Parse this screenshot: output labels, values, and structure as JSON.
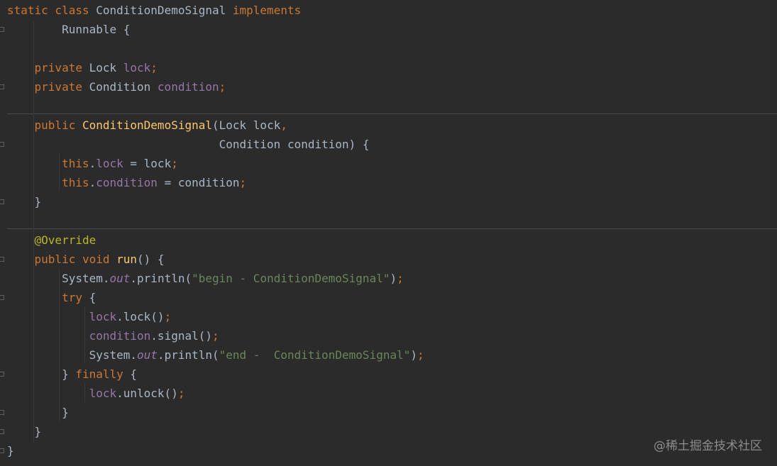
{
  "colors": {
    "background": "#2b2b2b",
    "keyword": "#cc7832",
    "method": "#ffc66d",
    "field": "#9876aa",
    "string": "#6a8759",
    "annotation": "#bbb529",
    "plain": "#a9b7c6"
  },
  "code": {
    "lines": [
      [
        {
          "t": "static class ",
          "c": "kw"
        },
        {
          "t": "ConditionDemoSignal ",
          "c": "pl"
        },
        {
          "t": "implements",
          "c": "kw"
        }
      ],
      [
        {
          "t": "        Runnable {",
          "c": "pl"
        }
      ],
      [],
      [
        {
          "t": "    private ",
          "c": "kw"
        },
        {
          "t": "Lock ",
          "c": "pl"
        },
        {
          "t": "lock",
          "c": "fld"
        },
        {
          "t": ";",
          "c": "pn"
        }
      ],
      [
        {
          "t": "    private ",
          "c": "kw"
        },
        {
          "t": "Condition ",
          "c": "pl"
        },
        {
          "t": "condition",
          "c": "fld"
        },
        {
          "t": ";",
          "c": "pn"
        }
      ],
      [],
      [
        {
          "t": "    public ",
          "c": "kw"
        },
        {
          "t": "ConditionDemoSignal",
          "c": "fn"
        },
        {
          "t": "(Lock lock",
          "c": "pl"
        },
        {
          "t": ",",
          "c": "pn"
        }
      ],
      [
        {
          "t": "                               Condition condition) {",
          "c": "pl"
        }
      ],
      [
        {
          "t": "        this",
          "c": "kw"
        },
        {
          "t": ".",
          "c": "pl"
        },
        {
          "t": "lock",
          "c": "fld"
        },
        {
          "t": " = lock",
          "c": "pl"
        },
        {
          "t": ";",
          "c": "pn"
        }
      ],
      [
        {
          "t": "        this",
          "c": "kw"
        },
        {
          "t": ".",
          "c": "pl"
        },
        {
          "t": "condition",
          "c": "fld"
        },
        {
          "t": " = condition",
          "c": "pl"
        },
        {
          "t": ";",
          "c": "pn"
        }
      ],
      [
        {
          "t": "    }",
          "c": "pl"
        }
      ],
      [],
      [
        {
          "t": "    @Override",
          "c": "ann"
        }
      ],
      [
        {
          "t": "    public void ",
          "c": "kw"
        },
        {
          "t": "run",
          "c": "fn"
        },
        {
          "t": "() {",
          "c": "pl"
        }
      ],
      [
        {
          "t": "        System.",
          "c": "pl"
        },
        {
          "t": "out",
          "c": "sfld"
        },
        {
          "t": ".println(",
          "c": "pl"
        },
        {
          "t": "\"begin - ConditionDemoSignal\"",
          "c": "str"
        },
        {
          "t": ")",
          "c": "pl"
        },
        {
          "t": ";",
          "c": "pn"
        }
      ],
      [
        {
          "t": "        try ",
          "c": "kw"
        },
        {
          "t": "{",
          "c": "pl"
        }
      ],
      [
        {
          "t": "            lock",
          "c": "fld"
        },
        {
          "t": ".lock()",
          "c": "pl"
        },
        {
          "t": ";",
          "c": "pn"
        }
      ],
      [
        {
          "t": "            condition",
          "c": "fld"
        },
        {
          "t": ".signal()",
          "c": "pl"
        },
        {
          "t": ";",
          "c": "pn"
        }
      ],
      [
        {
          "t": "            System.",
          "c": "pl"
        },
        {
          "t": "out",
          "c": "sfld"
        },
        {
          "t": ".println(",
          "c": "pl"
        },
        {
          "t": "\"end -  ConditionDemoSignal\"",
          "c": "str"
        },
        {
          "t": ")",
          "c": "pl"
        },
        {
          "t": ";",
          "c": "pn"
        }
      ],
      [
        {
          "t": "        } ",
          "c": "pl"
        },
        {
          "t": "finally ",
          "c": "kw"
        },
        {
          "t": "{",
          "c": "pl"
        }
      ],
      [
        {
          "t": "            lock",
          "c": "fld"
        },
        {
          "t": ".unlock()",
          "c": "pl"
        },
        {
          "t": ";",
          "c": "pn"
        }
      ],
      [
        {
          "t": "        }",
          "c": "pl"
        }
      ],
      [
        {
          "t": "    }",
          "c": "pl"
        }
      ],
      [
        {
          "t": "}",
          "c": "pl"
        }
      ]
    ]
  },
  "watermark": {
    "text": "@稀土掘金技术社区"
  }
}
